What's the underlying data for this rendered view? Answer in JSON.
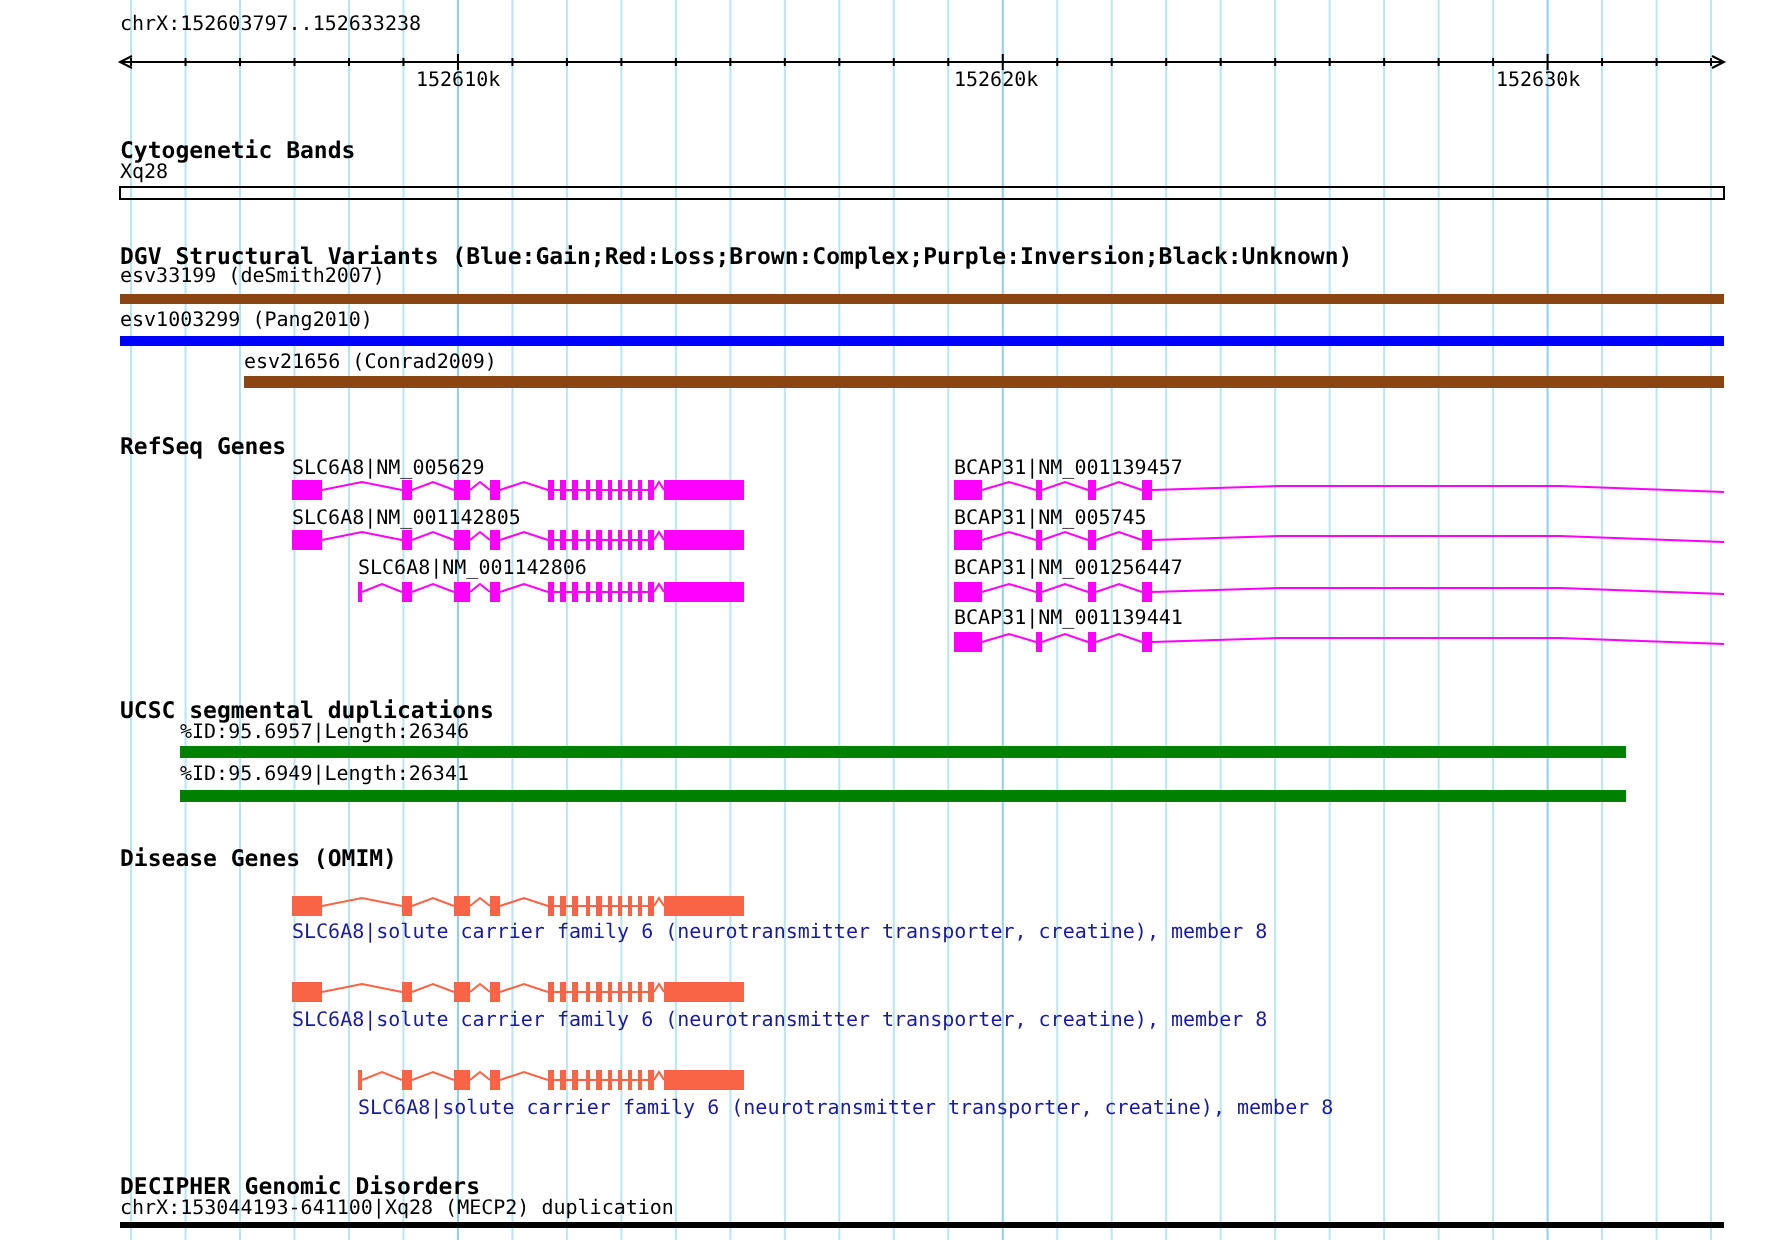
{
  "ruler": {
    "range": "chrX:152603797..152633238",
    "ticks": [
      "152610k",
      "152620k",
      "152630k"
    ]
  },
  "tracks": [
    {
      "title": "Cytogenetic Bands",
      "kind": "band",
      "features": [
        {
          "label": "Xq28"
        }
      ]
    },
    {
      "title": "DGV Structural Variants (Blue:Gain;Red:Loss;Brown:Complex;Purple:Inversion;Black:Unknown)",
      "kind": "variant",
      "features": [
        {
          "label": "esv33199 (deSmith2007)",
          "color": "#8b4513"
        },
        {
          "label": "esv1003299 (Pang2010)",
          "color": "#0000ff"
        },
        {
          "label": "esv21656 (Conrad2009)",
          "color": "#8b4513"
        }
      ]
    },
    {
      "title": "RefSeq Genes",
      "kind": "gene",
      "features": [
        {
          "label": "SLC6A8|NM_005629"
        },
        {
          "label": "BCAP31|NM_001139457"
        },
        {
          "label": "SLC6A8|NM_001142805"
        },
        {
          "label": "BCAP31|NM_005745"
        },
        {
          "label": "SLC6A8|NM_001142806"
        },
        {
          "label": "BCAP31|NM_001256447"
        },
        {
          "label": "BCAP31|NM_001139441"
        }
      ]
    },
    {
      "title": "UCSC segmental duplications",
      "kind": "duplication",
      "features": [
        {
          "label": "%ID:95.6957|Length:26346"
        },
        {
          "label": "%ID:95.6949|Length:26341"
        }
      ]
    },
    {
      "title": "Disease Genes (OMIM)",
      "kind": "disease",
      "features": [
        {
          "label": "SLC6A8|solute carrier family 6 (neurotransmitter transporter, creatine), member 8"
        },
        {
          "label": "SLC6A8|solute carrier family 6 (neurotransmitter transporter, creatine), member 8"
        },
        {
          "label": "SLC6A8|solute carrier family 6 (neurotransmitter transporter, creatine), member 8"
        }
      ]
    },
    {
      "title": "DECIPHER Genomic Disorders",
      "kind": "disorder",
      "features": [
        {
          "label": "chrX:153044193-641100|Xq28 (MECP2) duplication"
        }
      ]
    }
  ]
}
